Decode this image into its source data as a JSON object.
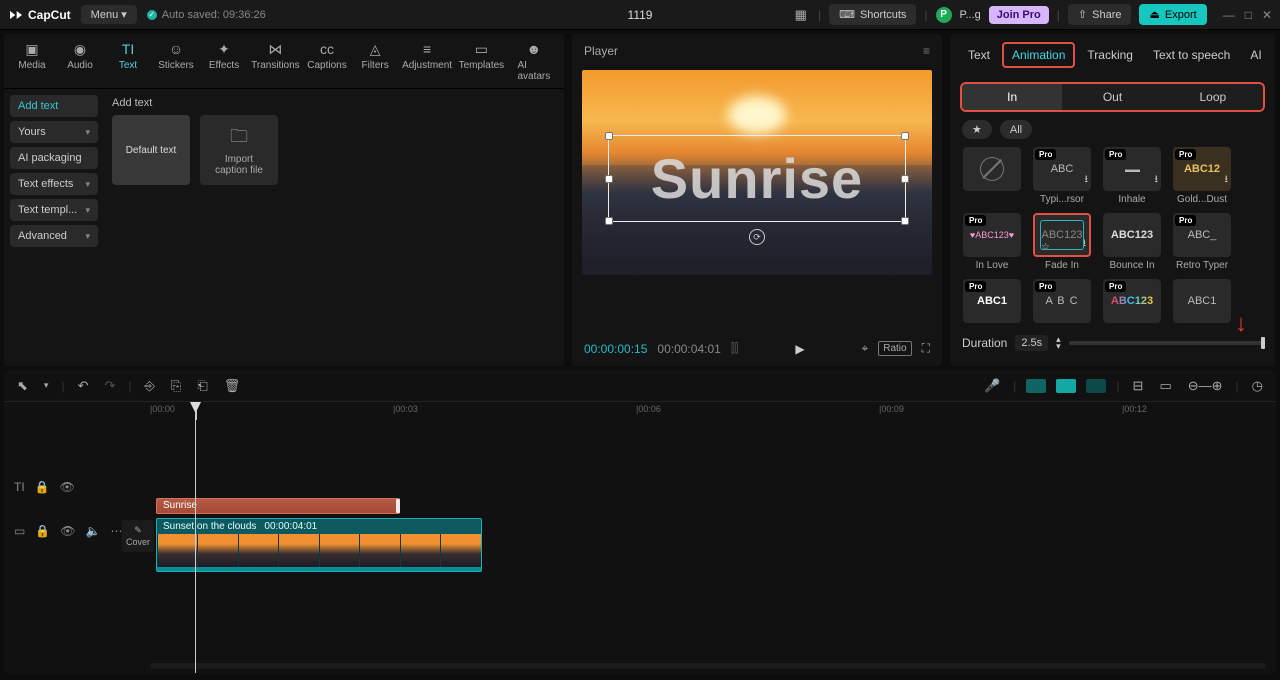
{
  "app": {
    "name": "CapCut",
    "menu": "Menu",
    "autosave": "Auto saved: 09:36:26",
    "project_title": "1119"
  },
  "topbar": {
    "shortcuts": "Shortcuts",
    "user_initial": "P",
    "user_name": "P...g",
    "join_pro": "Join Pro",
    "share": "Share",
    "export": "Export"
  },
  "tools": {
    "media": "Media",
    "audio": "Audio",
    "text": "Text",
    "stickers": "Stickers",
    "effects": "Effects",
    "transitions": "Transitions",
    "captions": "Captions",
    "filters": "Filters",
    "adjustment": "Adjustment",
    "templates": "Templates",
    "ai_avatars": "AI avatars"
  },
  "text_panel": {
    "add_text_heading": "Add text",
    "sidebar": [
      "Add text",
      "Yours",
      "AI packaging",
      "Text effects",
      "Text templ...",
      "Advanced"
    ],
    "card_default": "Default text",
    "card_import_l1": "Import",
    "card_import_l2": "caption file"
  },
  "player": {
    "title": "Player",
    "overlay_text": "Sunrise",
    "time_cur": "00:00:00:15",
    "time_total": "00:00:04:01",
    "ratio": "Ratio"
  },
  "right": {
    "tabs": [
      "Text",
      "Animation",
      "Tracking",
      "Text to speech",
      "AI avatars"
    ],
    "anim_types": [
      "In",
      "Out",
      "Loop"
    ],
    "filter_all": "All",
    "grid_r1": [
      "",
      "ABC",
      "",
      "ABC12"
    ],
    "labels_r1": [
      "",
      "Typi...rsor",
      "Inhale",
      "Gold...Dust"
    ],
    "grid_r2": [
      "ABC123",
      "ABC123",
      "ABC123",
      "ABC_"
    ],
    "labels_r2": [
      "In Love",
      "Fade In",
      "Bounce In",
      "Retro Typer"
    ],
    "grid_r3": [
      "ABC1",
      "A B C",
      "ABC123",
      "ABC1"
    ],
    "duration_label": "Duration",
    "duration_value": "2.5s"
  },
  "timeline": {
    "ticks": [
      "|00:00",
      "|00:03",
      "|00:06",
      "|00:09",
      "|00:12"
    ],
    "text_clip": "Sunrise",
    "video_name": "Sunset on the clouds",
    "video_dur": "00:00:04:01",
    "cover": "Cover"
  }
}
